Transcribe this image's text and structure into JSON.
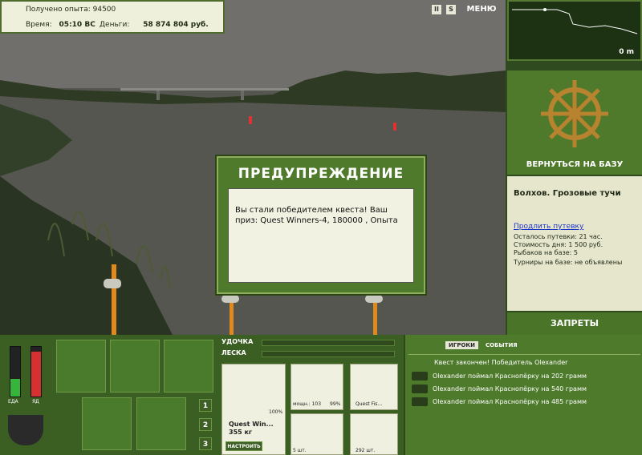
{
  "status": {
    "xp_label": "Получено опыта:",
    "xp_value": "94500",
    "time_label": "Время:",
    "time_value": "05:10 ВС",
    "money_label": "Деньги:",
    "money_value": "58 874 804 руб."
  },
  "top_buttons": {
    "pause": "II",
    "sound": "S",
    "menu": "МЕНЮ"
  },
  "map": {
    "depth_label": "0 m"
  },
  "base": {
    "return_label": "ВЕРНУТЬСЯ НА БАЗУ"
  },
  "location": {
    "title": "Волхов. Грозовые тучи",
    "extend_link": "Продлить путевку",
    "lines": [
      "Осталось путевки: 21 час.",
      "Стоимость дня: 1 500 руб.",
      "Рыбаков на базе: 5",
      "Турниры на базе: не объявлены"
    ]
  },
  "bans_label": "ЗАПРЕТЫ",
  "warning": {
    "title": "ПРЕДУПРЕЖДЕНИЕ",
    "message": "Вы стали победителем квеста! Ваш приз: Quest Winners-4, 180000 , Опыта"
  },
  "gauges": {
    "food_label": "ЕДА",
    "poison_label": "ЯД",
    "food_level": 0.35,
    "poison_level": 0.9
  },
  "inventory_pages": [
    "1",
    "2",
    "3"
  ],
  "rod": {
    "rod_label": "УДОЧКА",
    "line_label": "ЛЕСКА",
    "name": "Quest Win...",
    "weight": "355 кг",
    "percent": "100%",
    "setup_button": "НАСТРОИТЬ"
  },
  "tackle": [
    {
      "caption": "мощн.: 103",
      "extra": "99%"
    },
    {
      "caption": "Quest Fis..."
    },
    {
      "caption": "5 шт."
    },
    {
      "caption": "292 шт."
    }
  ],
  "events": {
    "tab_players": "ИГРОКИ",
    "tab_events": "СОБЫТИЯ",
    "items": [
      "Квест закончен! Победитель Olexander",
      "Olexander поймал Краснопёрку на 202 грамм",
      "Olexander поймал Краснопёрку на 540 грамм",
      "Olexander поймал Краснопёрку на 485 грамм"
    ]
  }
}
